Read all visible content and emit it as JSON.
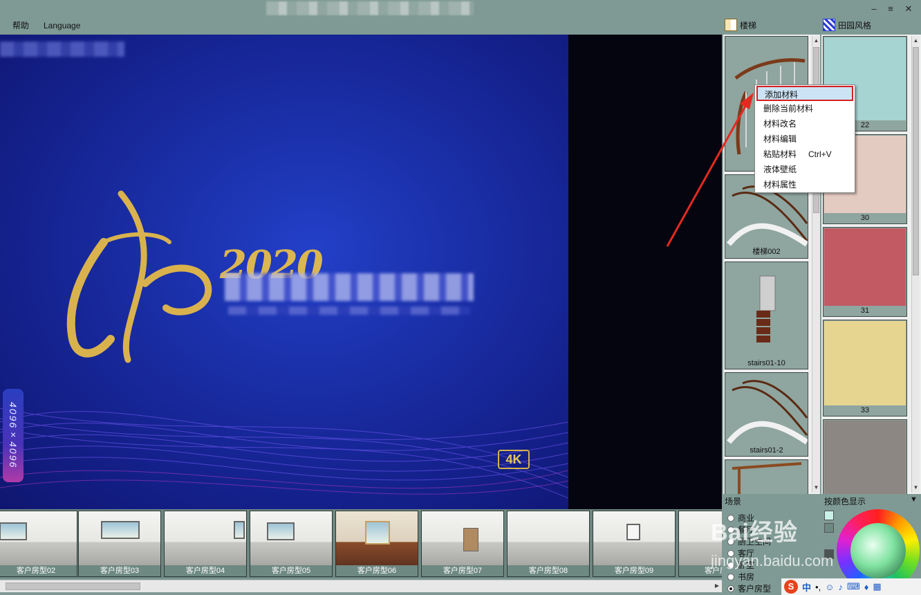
{
  "menu": {
    "help": "帮助",
    "language": "Language"
  },
  "window": {
    "min": "–",
    "max": "≡",
    "close": "✕"
  },
  "tabs": {
    "stairs": "楼梯",
    "pastoral": "田园风格"
  },
  "poster": {
    "year": "2020",
    "badge": "4K",
    "resolution": "4096×4096"
  },
  "context_menu": {
    "items": [
      {
        "label": "添加材料",
        "shortcut": ""
      },
      {
        "label": "删除当前材料",
        "shortcut": ""
      },
      {
        "label": "材料改名",
        "shortcut": ""
      },
      {
        "label": "材料编辑",
        "shortcut": ""
      },
      {
        "label": "粘贴材料",
        "shortcut": "Ctrl+V"
      },
      {
        "label": "液体壁纸",
        "shortcut": ""
      },
      {
        "label": "材料属性",
        "shortcut": ""
      }
    ]
  },
  "stairs": [
    {
      "label": "楼梯"
    },
    {
      "label": "楼梯002"
    },
    {
      "label": "stairs01-10"
    },
    {
      "label": "stairs01-2"
    }
  ],
  "materials": [
    {
      "label": "22",
      "color": "#a6d4d2"
    },
    {
      "label": "30",
      "color": "#e4cbc1"
    },
    {
      "label": "31",
      "color": "#c25a64"
    },
    {
      "label": "33",
      "color": "#e6d591"
    },
    {
      "label": "",
      "color": "#8c8782"
    }
  ],
  "thumbnails": [
    {
      "label": "客户房型02"
    },
    {
      "label": "客户房型03"
    },
    {
      "label": "客户房型04"
    },
    {
      "label": "客户房型05"
    },
    {
      "label": "客户房型06"
    },
    {
      "label": "客户房型07"
    },
    {
      "label": "客户房型08"
    },
    {
      "label": "客户房型09"
    },
    {
      "label": "客户房型"
    }
  ],
  "scene": {
    "label": "场景",
    "options": [
      {
        "label": "商业",
        "selected": false
      },
      {
        "label": "餐厅",
        "selected": false
      },
      {
        "label": "厨卫生间",
        "selected": false
      },
      {
        "label": "客厅",
        "selected": false
      },
      {
        "label": "卧室",
        "selected": false
      },
      {
        "label": "书房",
        "selected": false
      },
      {
        "label": "客户房型",
        "selected": true
      }
    ]
  },
  "color_panel": {
    "label": "按颜色显示",
    "toggle": "▼"
  },
  "watermark": {
    "main": "Bai经验",
    "sub": "jingyan.baidu.com"
  },
  "ime": {
    "logo": "S",
    "lang": "中",
    "punct": "•,"
  }
}
